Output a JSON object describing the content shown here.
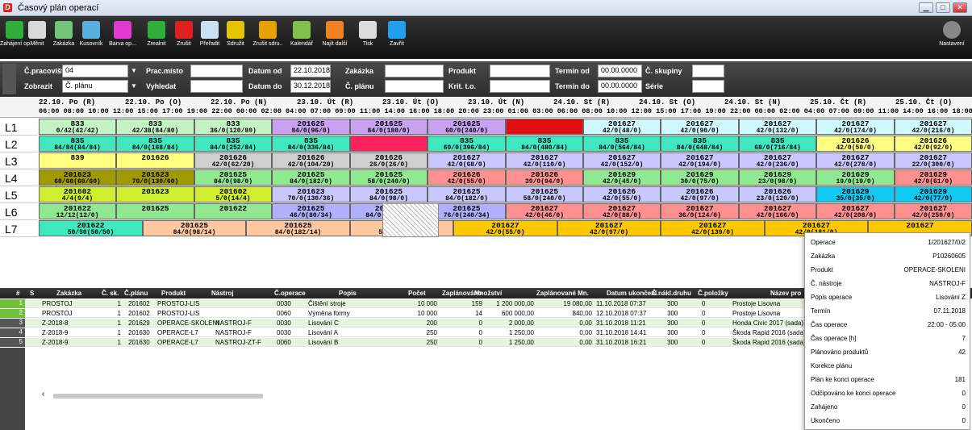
{
  "window": {
    "title": "Časový plán operací"
  },
  "toolbar": {
    "items": [
      {
        "label": "Zahájení op.",
        "color": "#2fae3a"
      },
      {
        "label": "Měnit",
        "color": "#d8d8d8"
      },
      {
        "label": "Zakázka",
        "color": "#74c37a"
      },
      {
        "label": "Kusovník",
        "color": "#58b0de"
      },
      {
        "label": "Barva op...",
        "color": "#e03ad0"
      },
      {
        "label": "Zrealnit",
        "color": "#2fae3a"
      },
      {
        "label": "Zrušit",
        "color": "#e02020"
      },
      {
        "label": "Přeřadit",
        "color": "#cbe0f2"
      },
      {
        "label": "Sdružit",
        "color": "#e2c400"
      },
      {
        "label": "Zrušit sdru..",
        "color": "#e8a000"
      },
      {
        "label": "Kalendář",
        "color": "#7fbf4b"
      },
      {
        "label": "Najít další",
        "color": "#f08020"
      },
      {
        "label": "Tisk",
        "color": "#dcdcdc"
      },
      {
        "label": "Zavřít",
        "color": "#22a0f0"
      }
    ],
    "settings_label": "Nastavení"
  },
  "filters": {
    "pracoviste_label": "Č.pracoviště",
    "pracoviste_value": "04",
    "pracmisto_label": "Prac.místo",
    "pracmisto_value": "",
    "datum_od_label": "Datum od",
    "datum_od_value": "22.10.2018",
    "zakazka_label": "Zakázka",
    "zakazka_value": "",
    "produkt_label": "Produkt",
    "produkt_value": "",
    "termin_od_label": "Termín od",
    "termin_od_value": "00.00.0000",
    "skupiny_label": "Č. skupiny",
    "skupiny_value": "",
    "zobrazit_label": "Zobrazit",
    "zobrazit_value": "Č. plánu",
    "vyhledat_label": "Vyhledat",
    "vyhledat_value": "",
    "datum_do_label": "Datum do",
    "datum_do_value": "30.12.2018",
    "cplanu_label": "Č. plánu",
    "cplanu_value": "",
    "krit_label": "Krit. t.o.",
    "krit_value": "",
    "termin_do_label": "Termín do",
    "termin_do_value": "00.00.0000",
    "serie_label": "Série",
    "serie_value": ""
  },
  "timeline": {
    "days": [
      "22.10. Po (R)",
      "22.10. Po (O)",
      "22.10. Po (N)",
      "23.10. Út (R)",
      "23.10. Út (O)",
      "23.10. Út (N)",
      "24.10. St (R)",
      "24.10. St (O)",
      "24.10. St (N)",
      "25.10. Čt (R)",
      "25.10. Čt (O)"
    ],
    "hours": "06:00 08:00 10:00 12:00 15:00 17:00 19:00 22:00 00:00 02:00 04:00 07:00 09:00 11:00 14:00 16:00 18:00 20:00 23:00 01:00 03:00 06:00 08:00 10:00 12:00 15:00 17:00 19:00 22:00 00:00 02:00 04:00 07:00 09:00 11:00 14:00 16:00 18:00 20:"
  },
  "gantt": {
    "rows": [
      {
        "label": "L1",
        "blocks": [
          {
            "a": "833",
            "b": "0/42(42/42)",
            "c": "#c3f2c3"
          },
          {
            "a": "833",
            "b": "42/38(84/80)",
            "c": "#c3f2c3"
          },
          {
            "a": "833",
            "b": "36/0(120/80)",
            "c": "#c3f2c3"
          },
          {
            "a": "201625",
            "b": "84/0(96/0)",
            "c": "#c8a2f0"
          },
          {
            "a": "201625",
            "b": "84/0(180/0)",
            "c": "#c8a2f0"
          },
          {
            "a": "201625",
            "b": "60/0(240/0)",
            "c": "#c8a2f0"
          },
          {
            "a": "",
            "b": "",
            "c": "#e01010"
          },
          {
            "a": "201627",
            "b": "42/0(48/0)",
            "c": "#d0f8ff"
          },
          {
            "a": "201627",
            "b": "42/0(90/0)",
            "c": "#d0f8ff"
          },
          {
            "a": "201627",
            "b": "42/0(132/0)",
            "c": "#d0f8ff"
          },
          {
            "a": "201627",
            "b": "42/0(174/0)",
            "c": "#d0f8ff"
          },
          {
            "a": "201627",
            "b": "42/0(216/0)",
            "c": "#d0f8ff"
          }
        ]
      },
      {
        "label": "L2",
        "blocks": [
          {
            "a": "835",
            "b": "84/84(84/84)",
            "c": "#40e8c0"
          },
          {
            "a": "835",
            "b": "84/0(168/84)",
            "c": "#40e8c0"
          },
          {
            "a": "835",
            "b": "84/0(252/84)",
            "c": "#40e8c0"
          },
          {
            "a": "835",
            "b": "84/0(336/84)",
            "c": "#40e8c0"
          },
          {
            "a": "",
            "b": "",
            "c": "#ff2060"
          },
          {
            "a": "835",
            "b": "60/0(396/84)",
            "c": "#40e8c0"
          },
          {
            "a": "835",
            "b": "84/0(480/84)",
            "c": "#40e8c0"
          },
          {
            "a": "835",
            "b": "84/0(564/84)",
            "c": "#40e8c0"
          },
          {
            "a": "835",
            "b": "84/0(648/84)",
            "c": "#40e8c0"
          },
          {
            "a": "835",
            "b": "68/0(716/84)",
            "c": "#40e8c0"
          },
          {
            "a": "201626",
            "b": "42/0(50/0)",
            "c": "#ffff80"
          },
          {
            "a": "201626",
            "b": "42/0(92/0)",
            "c": "#ffff80"
          }
        ]
      },
      {
        "label": "L3",
        "blocks": [
          {
            "a": "839",
            "b": "",
            "c": "#ffff80"
          },
          {
            "a": "201626",
            "b": "",
            "c": "#ffff80"
          },
          {
            "a": "201626",
            "b": "42/0(62/20)",
            "c": "#cfcfcf"
          },
          {
            "a": "201626",
            "b": "42/0(104/20)",
            "c": "#cfcfcf"
          },
          {
            "a": "201626",
            "b": "26/0(26/0)",
            "c": "#cfcfcf"
          },
          {
            "a": "201627",
            "b": "42/0(68/0)",
            "c": "#c8c8ff"
          },
          {
            "a": "201627",
            "b": "42/0(110/0)",
            "c": "#c8c8ff"
          },
          {
            "a": "201627",
            "b": "42/0(152/0)",
            "c": "#c8c8ff"
          },
          {
            "a": "201627",
            "b": "42/0(194/0)",
            "c": "#c8c8ff"
          },
          {
            "a": "201627",
            "b": "42/0(236/0)",
            "c": "#c8c8ff"
          },
          {
            "a": "201627",
            "b": "42/0(278/0)",
            "c": "#c8c8ff"
          },
          {
            "a": "201627",
            "b": "22/0(300/0)",
            "c": "#c8c8ff"
          }
        ]
      },
      {
        "label": "L4",
        "blocks": [
          {
            "a": "201623",
            "b": "60/60(60/60)",
            "c": "#a09a00"
          },
          {
            "a": "201623",
            "b": "70/0(130/60)",
            "c": "#a09a00"
          },
          {
            "a": "201625",
            "b": "84/0(98/0)",
            "c": "#90e890"
          },
          {
            "a": "201625",
            "b": "84/0(182/0)",
            "c": "#90e890"
          },
          {
            "a": "201625",
            "b": "58/0(240/0)",
            "c": "#90e890"
          },
          {
            "a": "201626",
            "b": "42/0(55/0)",
            "c": "#ff9090"
          },
          {
            "a": "201626",
            "b": "39/0(94/0)",
            "c": "#ff9090"
          },
          {
            "a": "201629",
            "b": "42/0(45/0)",
            "c": "#90e890"
          },
          {
            "a": "201629",
            "b": "30/0(75/0)",
            "c": "#90e890"
          },
          {
            "a": "201629",
            "b": "23/0(98/0)",
            "c": "#90e890"
          },
          {
            "a": "201629",
            "b": "19/0(19/0)",
            "c": "#90e890"
          },
          {
            "a": "201629",
            "b": "42/0(61/0)",
            "c": "#ff9090"
          }
        ]
      },
      {
        "label": "L5",
        "blocks": [
          {
            "a": "201602",
            "b": "4/4(9/4)",
            "c": "#cfee30"
          },
          {
            "a": "201623",
            "b": "",
            "c": "#cfee30"
          },
          {
            "a": "201602",
            "b": "5/0(14/4)",
            "c": "#cfee30"
          },
          {
            "a": "201623",
            "b": "70/0(130/36)",
            "c": "#c8c8ff"
          },
          {
            "a": "201625",
            "b": "84/0(98/0)",
            "c": "#c8c8ff"
          },
          {
            "a": "201625",
            "b": "84/0(182/0)",
            "c": "#c8c8ff"
          },
          {
            "a": "201625",
            "b": "58/0(240/0)",
            "c": "#c8c8ff"
          },
          {
            "a": "201626",
            "b": "42/0(55/0)",
            "c": "#c8c8ff"
          },
          {
            "a": "201626",
            "b": "42/0(97/0)",
            "c": "#c8c8ff"
          },
          {
            "a": "201626",
            "b": "23/0(120/0)",
            "c": "#c8c8ff"
          },
          {
            "a": "201629",
            "b": "35/0(35/0)",
            "c": "#10c8f0"
          },
          {
            "a": "201629",
            "b": "42/0(77/0)",
            "c": "#10c8f0"
          }
        ]
      },
      {
        "label": "L6",
        "blocks": [
          {
            "a": "201622",
            "b": "12/12(12/0)",
            "c": "#90e890"
          },
          {
            "a": "201625",
            "b": "",
            "c": "#90e890"
          },
          {
            "a": "201622",
            "b": "",
            "c": "#90e890"
          },
          {
            "a": "201625",
            "b": "46/0(80/34)",
            "c": "#b0b0ff"
          },
          {
            "a": "201625",
            "b": "84/0(164/34)",
            "c": "#b0b0ff"
          },
          {
            "a": "201625",
            "b": "76/0(240/34)",
            "c": "#b0b0ff"
          },
          {
            "a": "201627",
            "b": "42/0(46/0)",
            "c": "#ff9090"
          },
          {
            "a": "201627",
            "b": "42/0(88/0)",
            "c": "#ff9090"
          },
          {
            "a": "201627",
            "b": "36/0(124/0)",
            "c": "#ff9090"
          },
          {
            "a": "201627",
            "b": "42/0(166/0)",
            "c": "#ff9090"
          },
          {
            "a": "201627",
            "b": "42/0(208/0)",
            "c": "#ff9090"
          },
          {
            "a": "201627",
            "b": "42/0(250/0)",
            "c": "#ff9090"
          }
        ]
      },
      {
        "label": "L7",
        "blocks": [
          {
            "a": "201622",
            "b": "50/50(50/50)",
            "c": "#40e8c0"
          },
          {
            "a": "201625",
            "b": "84/0(98/14)",
            "c": "#ffc8a0"
          },
          {
            "a": "201625",
            "b": "84/0(182/14)",
            "c": "#ffc8a0"
          },
          {
            "a": "201625",
            "b": "58/0(240/14)",
            "c": "#ffc8a0"
          },
          {
            "a": "201627",
            "b": "42/0(55/0)",
            "c": "#ffc800"
          },
          {
            "a": "201627",
            "b": "42/0(97/0)",
            "c": "#ffc800"
          },
          {
            "a": "201627",
            "b": "42/0(139/0)",
            "c": "#ffc800"
          },
          {
            "a": "201627",
            "b": "42/0(181/0)",
            "c": "#ffc800"
          },
          {
            "a": "201627",
            "b": "",
            "c": "#ffc800"
          }
        ]
      }
    ]
  },
  "grid": {
    "headers": [
      "#",
      "S",
      "Zakázka",
      "Č. sk.",
      "Č.plánu",
      "Produkt",
      "Nástroj",
      "Č.operace",
      "Popis",
      "Počet",
      "Zaplánováno",
      "Množství",
      "Zaplánované Mn.",
      "Datum ukončení",
      "Č.nákl.druhu",
      "Č.položky",
      "Název pro"
    ],
    "rows": [
      {
        "n": "1",
        "zak": "PROSTOJ",
        "sk": "1",
        "plan": "201602",
        "prod": "PROSTOJ-LIS",
        "nas": "",
        "op": "0030",
        "pop": "Čištění stroje",
        "poc": "10 000",
        "zap": "159",
        "mn": "1 200 000,00",
        "zmn": "19 080,00",
        "dat": "11.10.2018 07:37",
        "nak": "300",
        "pol": "0",
        "naz": "Prostoje Lisovna"
      },
      {
        "n": "2",
        "zak": "PROSTOJ",
        "sk": "1",
        "plan": "201602",
        "prod": "PROSTOJ-LIS",
        "nas": "",
        "op": "0060",
        "pop": "Výměna formy",
        "poc": "10 000",
        "zap": "14",
        "mn": "600 000,00",
        "zmn": "840,00",
        "dat": "12.10.2018 07:37",
        "nak": "300",
        "pol": "0",
        "naz": "Prostoje Lisovna"
      },
      {
        "n": "3",
        "zak": "Z-2018-8",
        "sk": "1",
        "plan": "201629",
        "prod": "OPERACE-SKOLENI",
        "nas": "NASTROJ-F",
        "op": "0030",
        "pop": "Lisování C",
        "poc": "200",
        "zap": "0",
        "mn": "2 000,00",
        "zmn": "0,00",
        "dat": "31.10.2018 11:21",
        "nak": "300",
        "pol": "0",
        "naz": "Honda Civic 2017 (sada)"
      },
      {
        "n": "4",
        "zak": "Z-2018-9",
        "sk": "1",
        "plan": "201630",
        "prod": "OPERACE-L7",
        "nas": "NASTROJ-F",
        "op": "0030",
        "pop": "Lisování A",
        "poc": "250",
        "zap": "0",
        "mn": "1 250,00",
        "zmn": "0,00",
        "dat": "31.10.2018 14:41",
        "nak": "300",
        "pol": "0",
        "naz": "Škoda Rapid 2016 (sada)"
      },
      {
        "n": "5",
        "zak": "Z-2018-9",
        "sk": "1",
        "plan": "201630",
        "prod": "OPERACE-L7",
        "nas": "NASTROJ-ZT-F",
        "op": "0060",
        "pop": "Lisování B",
        "poc": "250",
        "zap": "0",
        "mn": "1 250,00",
        "zmn": "0,00",
        "dat": "31.10.2018 16:21",
        "nak": "300",
        "pol": "0",
        "naz": "Škoda Rapid 2016 (sada)"
      }
    ]
  },
  "tooltip": {
    "rows": [
      {
        "k": "Operace",
        "v": "1/201627/0/2"
      },
      {
        "k": "Zakázka",
        "v": "P10260605"
      },
      {
        "k": "Produkt",
        "v": "OPERACE-SKOLENI"
      },
      {
        "k": "Č. nástroje",
        "v": "NASTROJ-F"
      },
      {
        "k": "Popis operace",
        "v": "Lisování Z"
      },
      {
        "k": "Termín",
        "v": "07.11.2018"
      },
      {
        "k": "Čas operace",
        "v": "22:00 - 05:00"
      },
      {
        "k": "Čas operace [h]",
        "v": "7"
      },
      {
        "k": "Plánováno produktů",
        "v": "42"
      },
      {
        "k": "Korekce plánu",
        "v": ""
      },
      {
        "k": "Plán ke konci operace",
        "v": "181"
      },
      {
        "k": "Odčipováno ke konci operace",
        "v": "0"
      },
      {
        "k": "Zahájeno",
        "v": "0"
      },
      {
        "k": "Ukončeno",
        "v": "0"
      }
    ]
  }
}
